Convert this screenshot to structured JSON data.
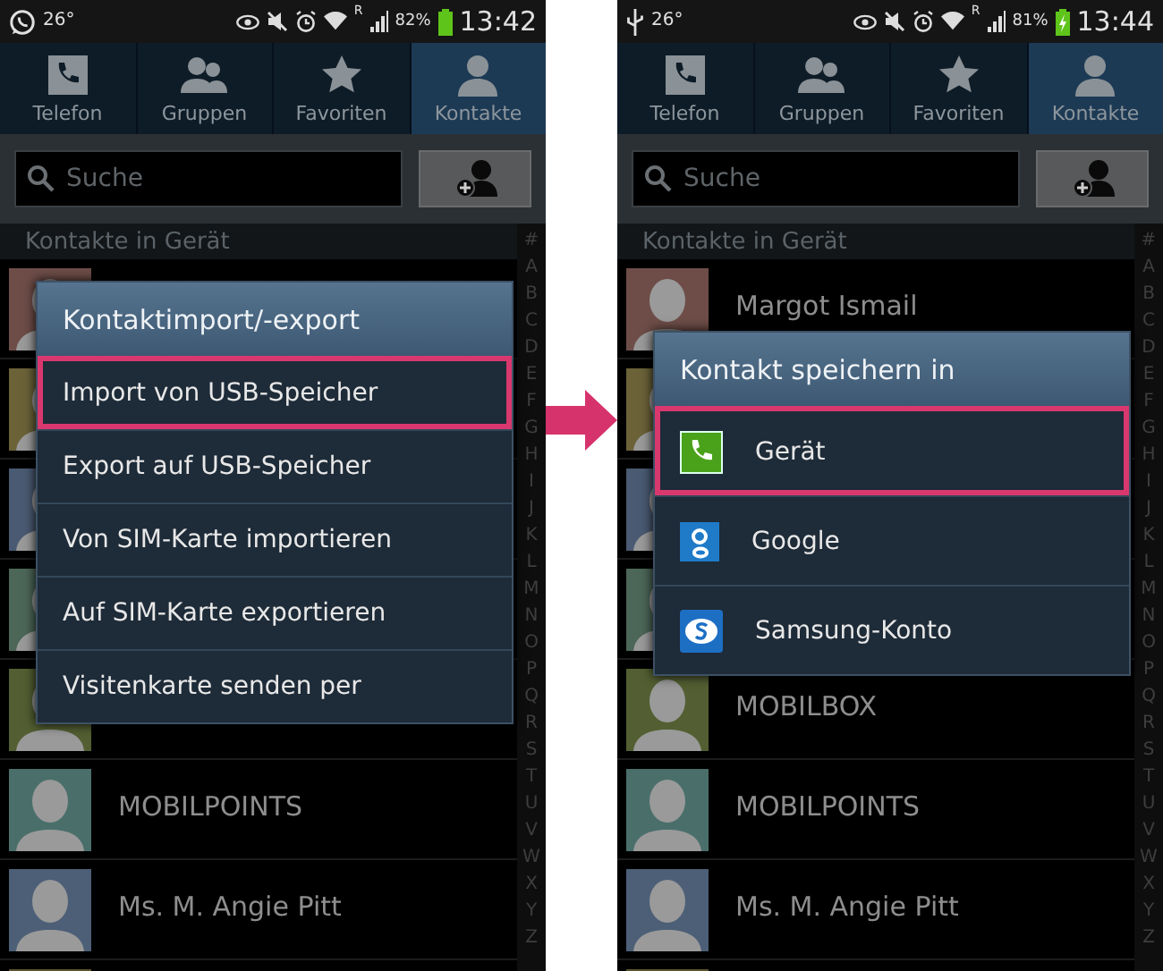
{
  "panels": [
    {
      "status_bar": {
        "notification": {
          "kind": "chat"
        },
        "temperature": "26°",
        "roaming": "R",
        "battery": "82%",
        "charging": false,
        "time": "13:42"
      },
      "tabs": [
        {
          "label": "Telefon",
          "kind": "phone",
          "selected": false
        },
        {
          "label": "Gruppen",
          "kind": "group",
          "selected": false
        },
        {
          "label": "Favoriten",
          "kind": "star",
          "selected": false
        },
        {
          "label": "Kontakte",
          "kind": "person",
          "selected": true
        }
      ],
      "search": {
        "placeholder": "Suche"
      },
      "section_header": "Kontakte in Gerät",
      "contacts": [
        {
          "color": "#6e4d48"
        },
        {
          "color": "#6b6238"
        },
        {
          "color": "#4a5a72"
        },
        {
          "color": "#4c6658"
        },
        {
          "color": "#535f32"
        },
        {
          "name": "MOBILPOINTS",
          "color": "#4a6f6b"
        },
        {
          "name": "Ms. M. Angie Pitt",
          "color": "#4c5f77"
        },
        {
          "color": "#5c5230"
        }
      ],
      "index": [
        "#",
        "A",
        "B",
        "C",
        "D",
        "E",
        "F",
        "G",
        "H",
        "I",
        "J",
        "K",
        "L",
        "M",
        "N",
        "O",
        "P",
        "Q",
        "R",
        "S",
        "T",
        "U",
        "V",
        "W",
        "X",
        "Y",
        "Z"
      ],
      "dialog": {
        "title": "Kontaktimport/-export",
        "items": [
          {
            "label": "Import von USB-Speicher",
            "kind": "text",
            "highlighted": true
          },
          {
            "label": "Export auf USB-Speicher",
            "kind": "text",
            "highlighted": false
          },
          {
            "label": "Von SIM-Karte importieren",
            "kind": "text",
            "highlighted": false
          },
          {
            "label": "Auf SIM-Karte exportieren",
            "kind": "text",
            "highlighted": false
          },
          {
            "label": "Visitenkarte senden per",
            "kind": "text",
            "highlighted": false
          }
        ]
      }
    },
    {
      "status_bar": {
        "notification": {
          "kind": "usb"
        },
        "temperature": "26°",
        "roaming": "R",
        "battery": "81%",
        "charging": true,
        "time": "13:44"
      },
      "tabs": [
        {
          "label": "Telefon",
          "kind": "phone",
          "selected": false
        },
        {
          "label": "Gruppen",
          "kind": "group",
          "selected": false
        },
        {
          "label": "Favoriten",
          "kind": "star",
          "selected": false
        },
        {
          "label": "Kontakte",
          "kind": "person",
          "selected": true
        }
      ],
      "search": {
        "placeholder": "Suche"
      },
      "section_header": "Kontakte in Gerät",
      "contacts": [
        {
          "name": "Margot Ismail",
          "color": "#6e4d48"
        },
        {
          "color": "#6b6238"
        },
        {
          "color": "#4a5a72"
        },
        {
          "color": "#4c6658"
        },
        {
          "name": "MOBILBOX",
          "color": "#535f32"
        },
        {
          "name": "MOBILPOINTS",
          "color": "#4a6f6b"
        },
        {
          "name": "Ms. M. Angie Pitt",
          "color": "#4c5f77"
        },
        {
          "color": "#5c5230"
        }
      ],
      "index": [
        "#",
        "A",
        "B",
        "C",
        "D",
        "E",
        "F",
        "G",
        "H",
        "I",
        "J",
        "K",
        "L",
        "M",
        "N",
        "O",
        "P",
        "Q",
        "R",
        "S",
        "T",
        "U",
        "V",
        "W",
        "X",
        "Y",
        "Z"
      ],
      "dialog": {
        "title": "Kontakt speichern in",
        "items": [
          {
            "label": "Gerät",
            "kind": "device",
            "highlighted": true
          },
          {
            "label": "Google",
            "kind": "google",
            "highlighted": false
          },
          {
            "label": "Samsung-Konto",
            "kind": "samsung",
            "highlighted": false
          }
        ]
      }
    }
  ]
}
